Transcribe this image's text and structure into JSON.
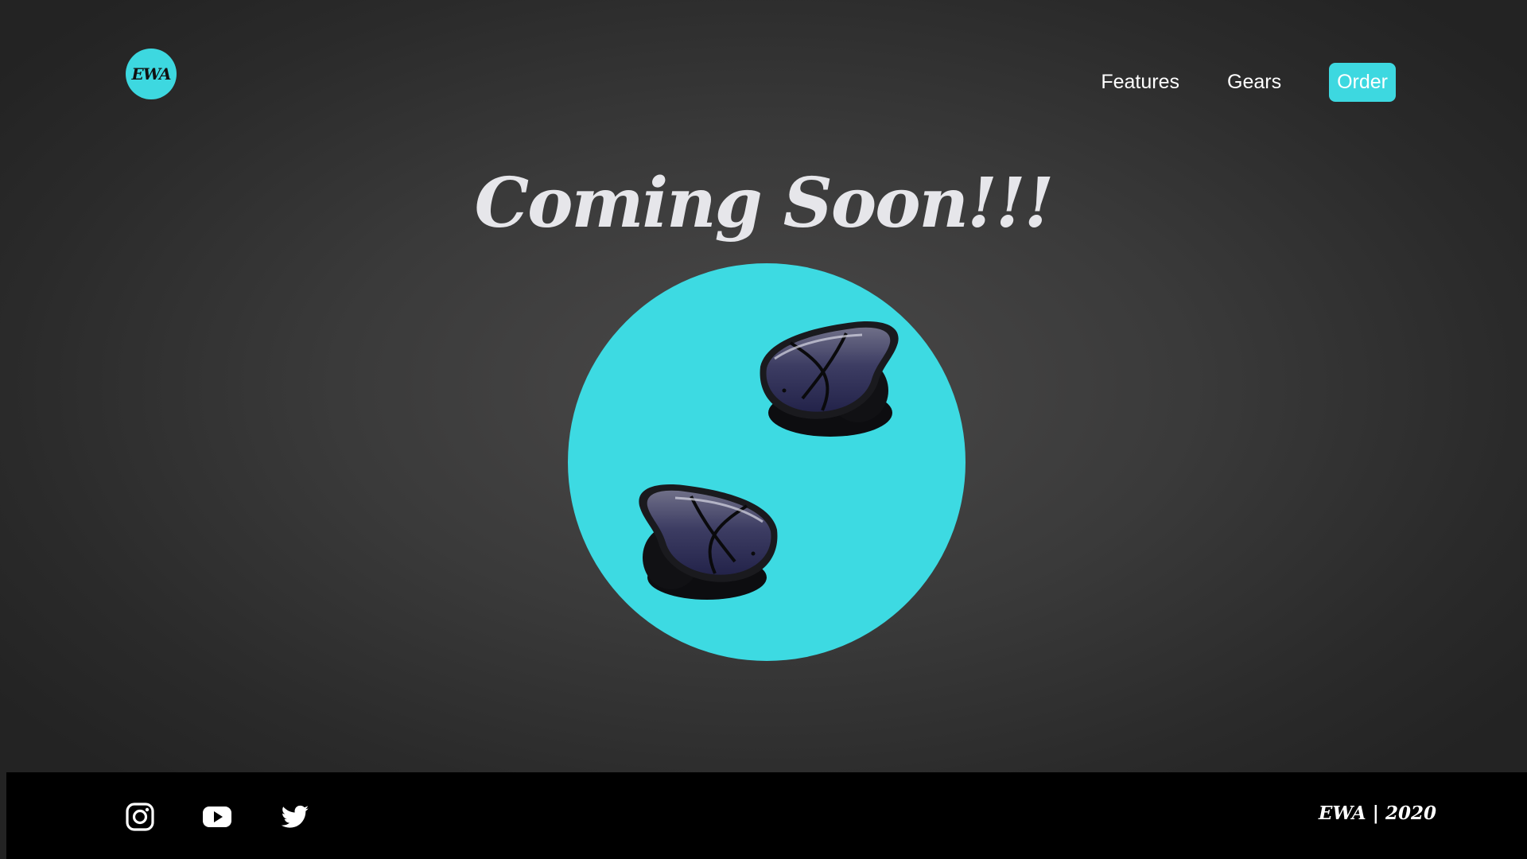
{
  "brand": {
    "logo_text": "EWA",
    "accent_color": "#3dd8e0"
  },
  "nav": {
    "items": [
      {
        "label": "Features"
      },
      {
        "label": "Gears"
      }
    ],
    "order_label": "Order"
  },
  "hero": {
    "title": "Coming Soon!!!",
    "image": "wireless-earbuds"
  },
  "footer": {
    "social": [
      {
        "icon": "instagram-icon"
      },
      {
        "icon": "youtube-icon"
      },
      {
        "icon": "twitter-icon"
      }
    ],
    "copyright": "EWA | 2020"
  }
}
